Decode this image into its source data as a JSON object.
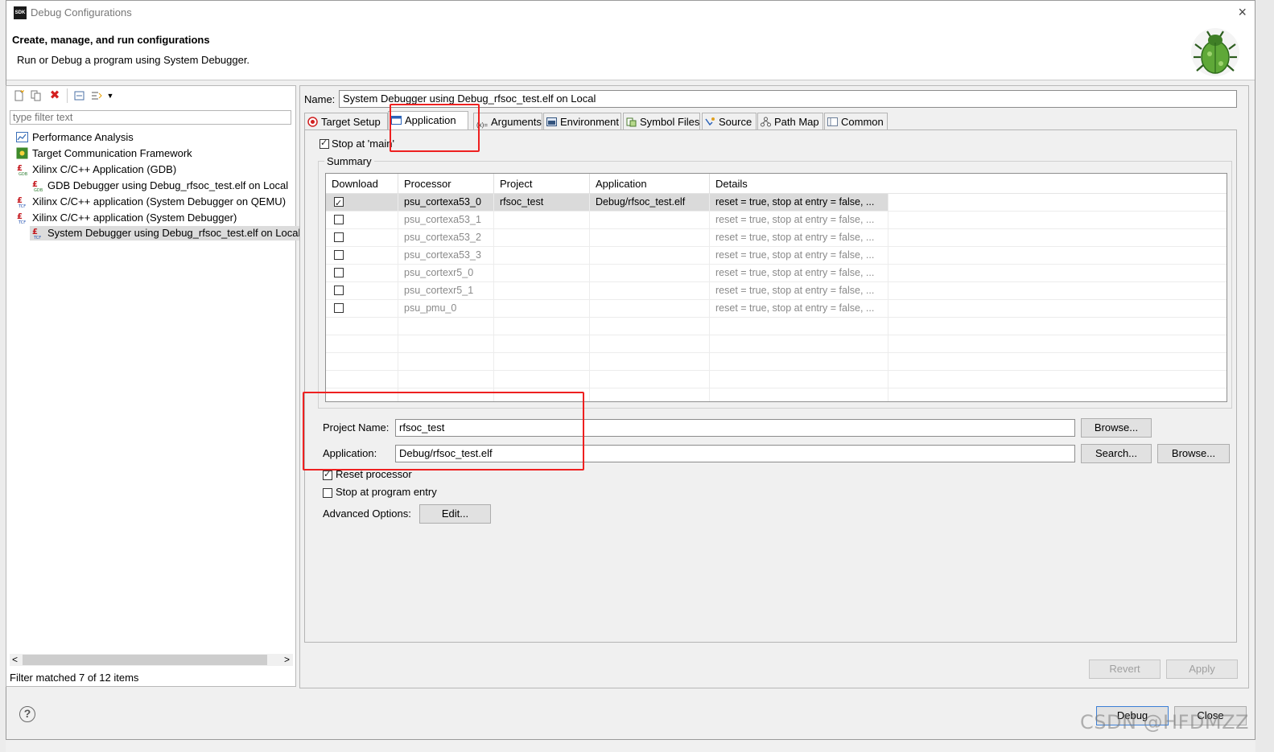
{
  "window": {
    "app_icon": "SDK",
    "title": "Debug Configurations",
    "close_icon": "×"
  },
  "header": {
    "title": "Create, manage, and run configurations",
    "description": "Run or Debug a program using System Debugger."
  },
  "left_panel": {
    "filter_placeholder": "type filter text",
    "tree": [
      {
        "label": "Performance Analysis",
        "icon": "chart-icon",
        "level": 0
      },
      {
        "label": "Target Communication Framework",
        "icon": "tcf-icon",
        "level": 0
      },
      {
        "label": "Xilinx C/C++ Application (GDB)",
        "icon": "xilinx-gdb-icon",
        "level": 0
      },
      {
        "label": "GDB Debugger using Debug_rfsoc_test.elf on Local",
        "icon": "xilinx-gdb-icon",
        "level": 1
      },
      {
        "label": "Xilinx C/C++ application (System Debugger on QEMU)",
        "icon": "xilinx-tcf-icon",
        "level": 0
      },
      {
        "label": "Xilinx C/C++ application (System Debugger)",
        "icon": "xilinx-tcf-icon",
        "level": 0
      },
      {
        "label": "System Debugger using Debug_rfsoc_test.elf on Local",
        "icon": "xilinx-tcf-icon",
        "level": 1,
        "selected": true
      }
    ],
    "filter_status": "Filter matched 7 of 12 items",
    "scroll_left": "<",
    "scroll_right": ">"
  },
  "config": {
    "name_label": "Name:",
    "name_value": "System Debugger using Debug_rfsoc_test.elf on Local",
    "tabs": [
      {
        "label": "Target Setup",
        "icon": "target-icon"
      },
      {
        "label": "Application",
        "icon": "window-icon",
        "active": true
      },
      {
        "label": "Arguments",
        "icon": "arguments-icon",
        "icon_text": "(x)="
      },
      {
        "label": "Environment",
        "icon": "environment-icon"
      },
      {
        "label": "Symbol Files",
        "icon": "symbol-files-icon"
      },
      {
        "label": "Source",
        "icon": "source-icon"
      },
      {
        "label": "Path Map",
        "icon": "path-map-icon"
      },
      {
        "label": "Common",
        "icon": "common-icon"
      }
    ],
    "stop_at_main": {
      "label": "Stop at 'main'",
      "checked": true
    },
    "summary": {
      "label": "Summary",
      "columns": [
        "Download",
        "Processor",
        "Project",
        "Application",
        "Details"
      ],
      "rows": [
        {
          "download": true,
          "processor": "psu_cortexa53_0",
          "project": "rfsoc_test",
          "application": "Debug/rfsoc_test.elf",
          "details": "reset = true, stop at entry = false, ...",
          "selected": true
        },
        {
          "download": false,
          "processor": "psu_cortexa53_1",
          "project": "",
          "application": "",
          "details": "reset = true, stop at entry = false, ..."
        },
        {
          "download": false,
          "processor": "psu_cortexa53_2",
          "project": "",
          "application": "",
          "details": "reset = true, stop at entry = false, ..."
        },
        {
          "download": false,
          "processor": "psu_cortexa53_3",
          "project": "",
          "application": "",
          "details": "reset = true, stop at entry = false, ..."
        },
        {
          "download": false,
          "processor": "psu_cortexr5_0",
          "project": "",
          "application": "",
          "details": "reset = true, stop at entry = false, ..."
        },
        {
          "download": false,
          "processor": "psu_cortexr5_1",
          "project": "",
          "application": "",
          "details": "reset = true, stop at entry = false, ..."
        },
        {
          "download": false,
          "processor": "psu_pmu_0",
          "project": "",
          "application": "",
          "details": "reset = true, stop at entry = false, ..."
        }
      ]
    },
    "project_name_label": "Project Name:",
    "project_name_value": "rfsoc_test",
    "application_label": "Application:",
    "application_value": "Debug/rfsoc_test.elf",
    "browse_label": "Browse...",
    "search_label": "Search...",
    "reset_processor": {
      "label": "Reset processor",
      "checked": true
    },
    "stop_at_entry": {
      "label": "Stop at program entry",
      "checked": false
    },
    "advanced_label": "Advanced Options:",
    "edit_label": "Edit...",
    "revert_label": "Revert",
    "apply_label": "Apply"
  },
  "footer": {
    "help_icon": "?",
    "debug_label": "Debug",
    "close_label": "Close"
  },
  "watermark": "CSDN @HFDMZZ",
  "colors": {
    "highlight_red": "#ee2020",
    "selection_gray": "#dadada",
    "window_bg": "#f0f0f0"
  }
}
